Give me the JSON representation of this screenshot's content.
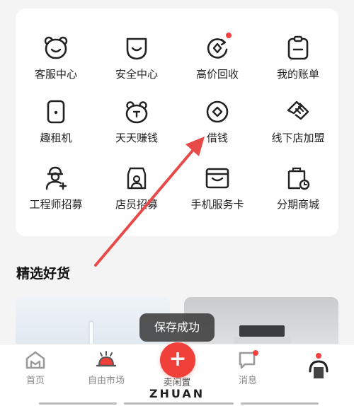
{
  "services": {
    "items": [
      {
        "label": "客服中心",
        "icon": "bear-face-icon"
      },
      {
        "label": "安全中心",
        "icon": "shield-smile-icon"
      },
      {
        "label": "高价回收",
        "icon": "recycle-icon",
        "badge": true
      },
      {
        "label": "我的账单",
        "icon": "clipboard-bill-icon"
      },
      {
        "label": "趣租机",
        "icon": "phone-icon"
      },
      {
        "label": "天天赚钱",
        "icon": "piggy-bear-icon"
      },
      {
        "label": "借钱",
        "icon": "coin-diamond-icon"
      },
      {
        "label": "线下店加盟",
        "icon": "handshake-icon"
      },
      {
        "label": "工程师招募",
        "icon": "engineer-add-icon"
      },
      {
        "label": "店员招募",
        "icon": "store-staff-icon"
      },
      {
        "label": "手机服务卡",
        "icon": "service-card-icon"
      },
      {
        "label": "分期商城",
        "icon": "installment-bag-icon"
      }
    ]
  },
  "section": {
    "title": "精选好货"
  },
  "toast": {
    "text": "保存成功"
  },
  "tabbar": {
    "home": "首页",
    "market": "自由市场",
    "sell": "卖闲置",
    "messages": "消息"
  },
  "watermark": "ZHUAN",
  "colors": {
    "accent": "#f0403a",
    "badge": "#f43f3f",
    "annotation_arrow": "#e84a4a"
  }
}
